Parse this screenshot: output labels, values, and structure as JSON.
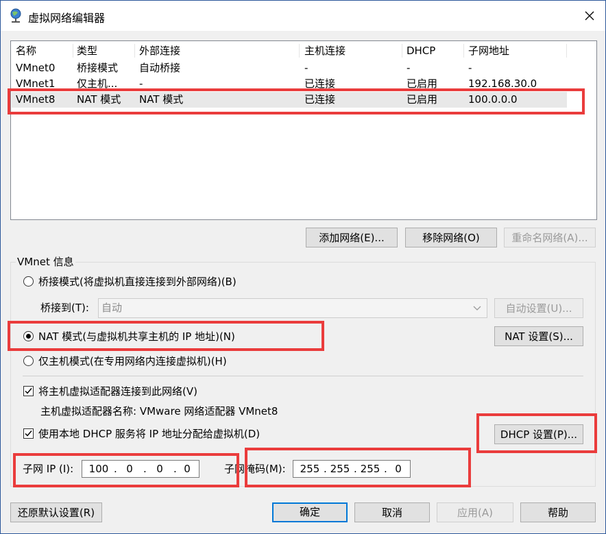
{
  "window": {
    "title": "虚拟网络编辑器"
  },
  "list": {
    "headers": [
      "名称",
      "类型",
      "外部连接",
      "主机连接",
      "DHCP",
      "子网地址"
    ],
    "rows": [
      [
        "VMnet0",
        "桥接模式",
        "自动桥接",
        "-",
        "-",
        "-"
      ],
      [
        "VMnet1",
        "仅主机...",
        "-",
        "已连接",
        "已启用",
        "192.168.30.0"
      ],
      [
        "VMnet8",
        "NAT 模式",
        "NAT 模式",
        "已连接",
        "已启用",
        "100.0.0.0"
      ]
    ]
  },
  "list_buttons": {
    "add": "添加网络(E)...",
    "remove": "移除网络(O)",
    "rename": "重命名网络(A)..."
  },
  "vmnet_info": {
    "title": "VMnet 信息",
    "bridge_radio": "桥接模式(将虚拟机直接连接到外部网络)(B)",
    "bridge_to_label": "桥接到(T):",
    "bridge_to_value": "自动",
    "auto_settings": "自动设置(U)...",
    "nat_radio": "NAT 模式(与虚拟机共享主机的 IP 地址)(N)",
    "nat_settings": "NAT 设置(S)...",
    "hostonly_radio": "仅主机模式(在专用网络内连接虚拟机)(H)",
    "connect_adapter": "将主机虚拟适配器连接到此网络(V)",
    "adapter_name": "主机虚拟适配器名称: VMware 网络适配器 VMnet8",
    "use_dhcp": "使用本地 DHCP 服务将 IP 地址分配给虚拟机(D)",
    "dhcp_settings": "DHCP 设置(P)...",
    "subnet_ip_label": "子网 IP (I):",
    "subnet_ip": [
      "100",
      "0",
      "0",
      "0"
    ],
    "subnet_mask_label": "子网掩码(M):",
    "subnet_mask": [
      "255",
      "255",
      "255",
      "0"
    ]
  },
  "footer": {
    "restore": "还原默认设置(R)",
    "ok": "确定",
    "cancel": "取消",
    "apply": "应用(A)",
    "help": "帮助"
  },
  "colors": {
    "highlight": "#ea3c3c",
    "focus": "#0078d7"
  }
}
